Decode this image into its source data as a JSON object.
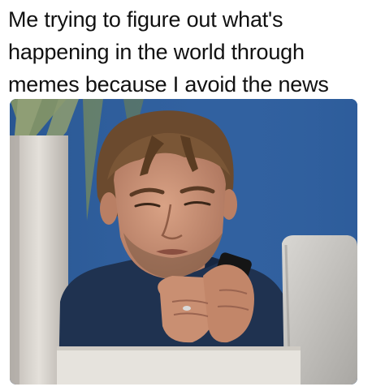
{
  "caption": {
    "line1": "Me trying to figure out what's",
    "line2": "happening in the world through",
    "line3": "memes because I avoid the news"
  },
  "photo": {
    "colors": {
      "wall": "#2f5f9e",
      "shirt": "#1f3250",
      "skin": "#c98f72",
      "hair": "#6b4a2e",
      "phone": "#151515",
      "chair": "#c9c7c3",
      "pillar": "#d8d4cf",
      "railing": "#e6e3dd",
      "leaves": "#8c9b62"
    },
    "icons": [
      "man-with-phone-illustration"
    ]
  }
}
